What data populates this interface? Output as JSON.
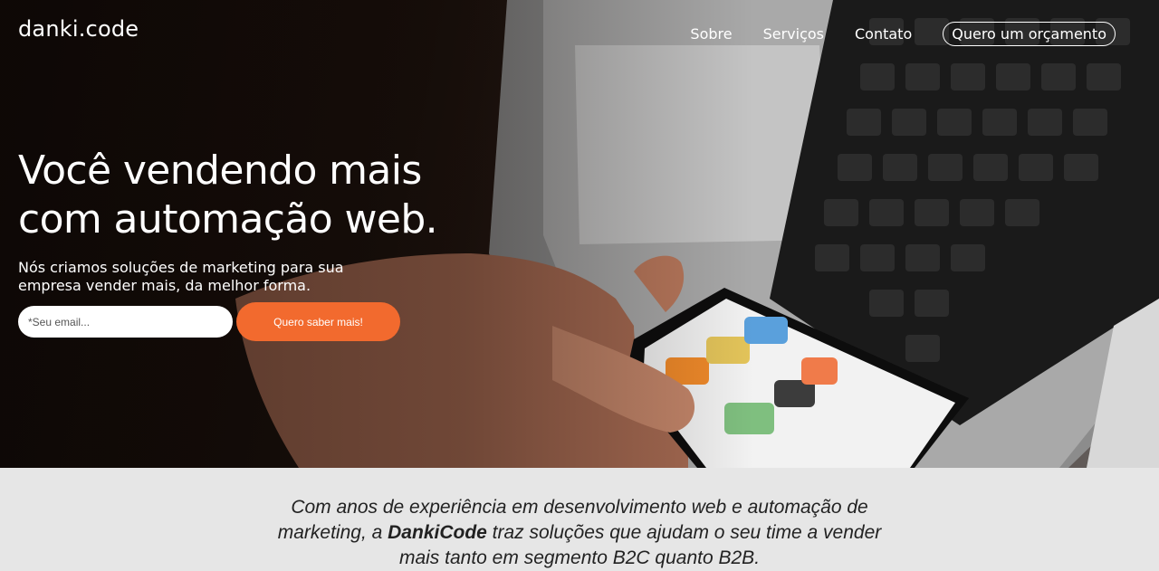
{
  "brand": {
    "logo_text": "danki.code"
  },
  "nav": {
    "items": [
      {
        "label": "Sobre"
      },
      {
        "label": "Serviços"
      },
      {
        "label": "Contato"
      }
    ],
    "cta_label": "Quero um orçamento"
  },
  "hero": {
    "headline_line1": "Você vendendo mais",
    "headline_line2": "com automação web.",
    "subhead": "Nós criamos soluções de marketing para sua empresa vender mais, da melhor forma.",
    "email_placeholder": "*Seu email...",
    "submit_label": "Quero saber mais!"
  },
  "about": {
    "text_before": "Com anos de experiência em desenvolvimento web e automação de marketing, a ",
    "brand_bold": "DankiCode",
    "text_after": " traz soluções que ajudam o seu time a vender mais tanto em segmento B2C quanto B2B."
  },
  "colors": {
    "accent": "#f26a2e",
    "hero_dark": "#120a07",
    "about_bg": "#e6e6e6"
  }
}
